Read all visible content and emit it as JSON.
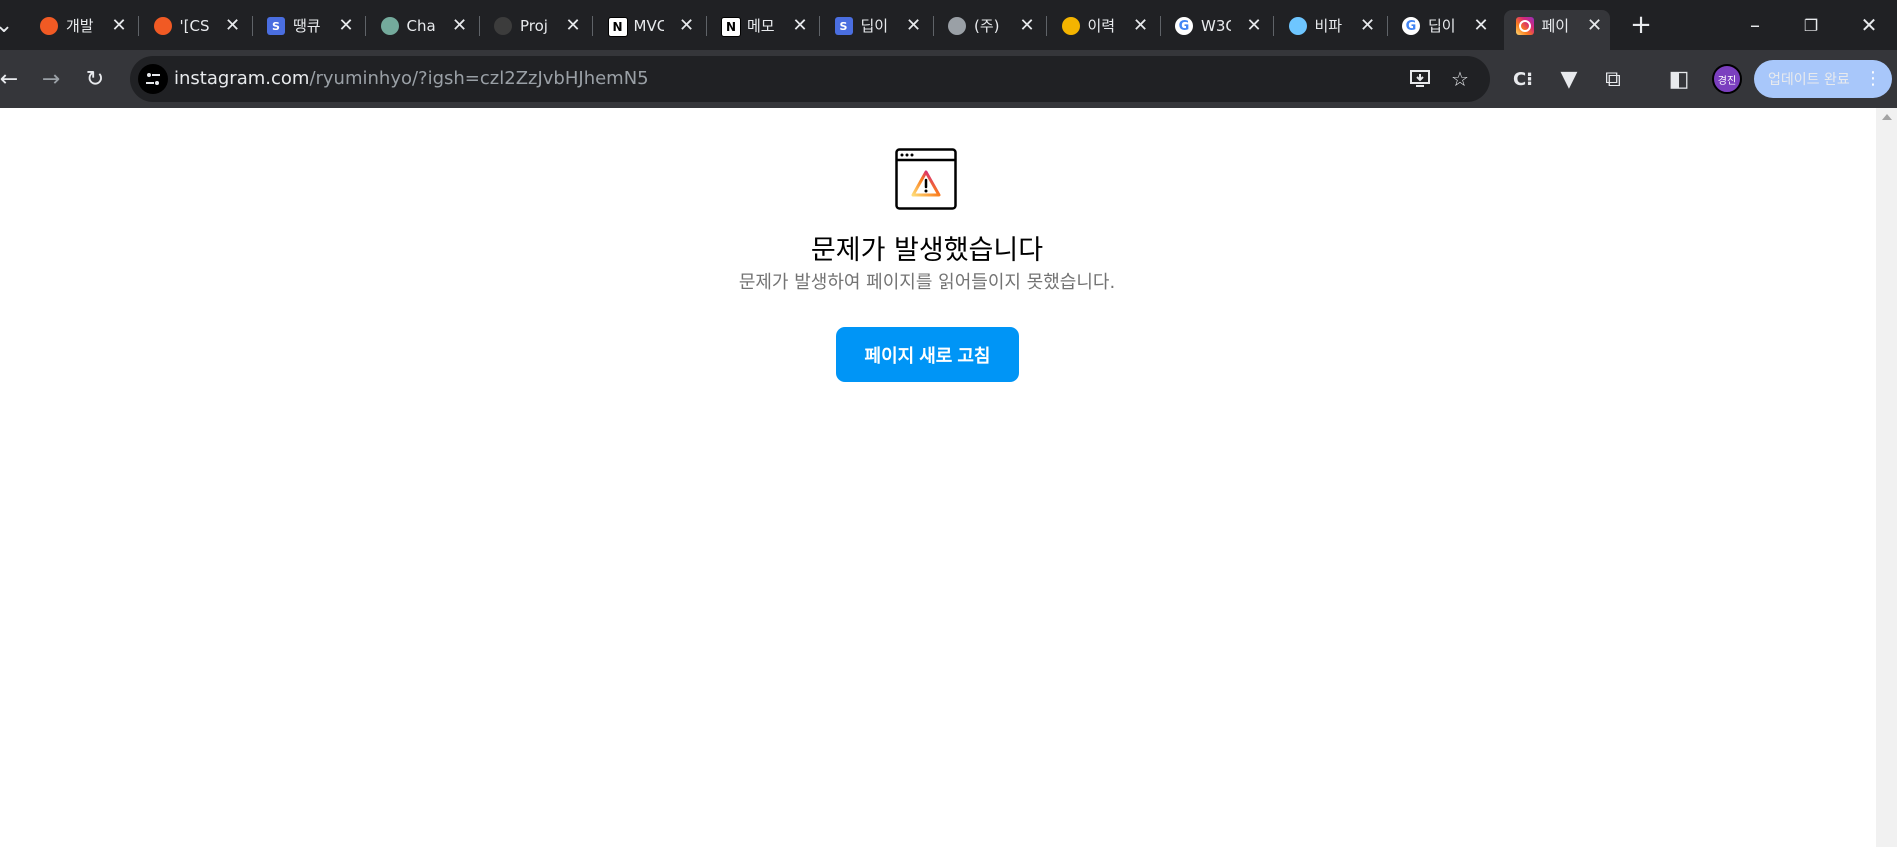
{
  "browser": {
    "tabs": [
      {
        "label": "개발",
        "icon": "tistory-icon",
        "color": "#f15a24"
      },
      {
        "label": "'[CS",
        "icon": "tistory-icon",
        "color": "#f15a24"
      },
      {
        "label": "땡큐",
        "icon": "s-icon",
        "color": "#4a6ee0"
      },
      {
        "label": "Cha",
        "icon": "chatgpt-icon",
        "color": "#74aa9c"
      },
      {
        "label": "Proj",
        "icon": "github-icon",
        "color": "#3c3c3c"
      },
      {
        "label": "MVC",
        "icon": "notion-icon",
        "color": "#ffffff"
      },
      {
        "label": "메모",
        "icon": "notion-icon",
        "color": "#ffffff"
      },
      {
        "label": "딥이",
        "icon": "s-icon",
        "color": "#4a6ee0"
      },
      {
        "label": "(주)",
        "icon": "globe-icon",
        "color": "#9aa0a6"
      },
      {
        "label": "이력",
        "icon": "person-icon",
        "color": "#f4b400"
      },
      {
        "label": "W3C",
        "icon": "google-icon",
        "color": "#ffffff"
      },
      {
        "label": "비파",
        "icon": "house-icon",
        "color": "#6ec6ff"
      },
      {
        "label": "딥이",
        "icon": "google-icon",
        "color": "#ffffff"
      },
      {
        "label": "페이",
        "icon": "instagram-icon",
        "color": "#d6249f"
      }
    ],
    "active_tab_index": 13,
    "address": {
      "host": "instagram.com",
      "path": "/ryuminhyo/?igsh=czl2ZzJvbHJhemN5"
    },
    "avatar_label": "경진",
    "update_button_label": "업데이트 완료"
  },
  "page": {
    "title": "문제가 발생했습니다",
    "description": "문제가 발생하여 페이지를 읽어들이지 못했습니다.",
    "refresh_button_label": "페이지 새로 고침"
  }
}
